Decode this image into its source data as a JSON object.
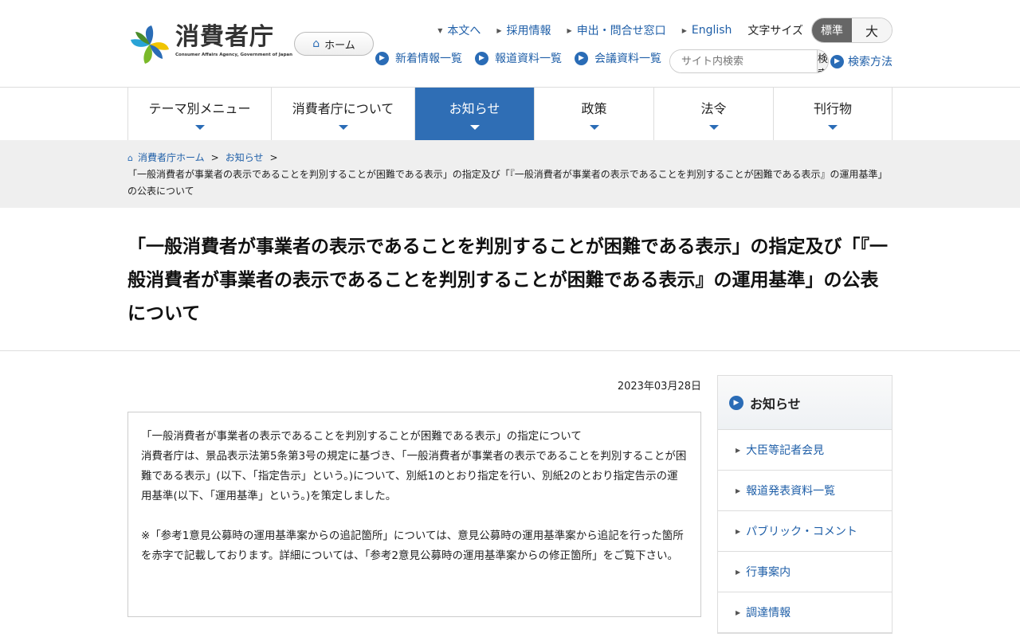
{
  "header": {
    "logo_text": "消費者庁",
    "logo_subtext": "Consumer Affairs Agency, Government of Japan",
    "home_label": "ホーム",
    "top_links": [
      "本文へ",
      "採用情報",
      "申出・問合せ窓口",
      "English"
    ],
    "font_size_label": "文字サイズ",
    "font_size_options": [
      "標準",
      "大"
    ],
    "sub_links": [
      "新着情報一覧",
      "報道資料一覧",
      "会議資料一覧"
    ],
    "search_placeholder": "サイト内検索",
    "search_button": "検索",
    "search_help": "検索方法"
  },
  "global_nav": [
    {
      "label": "テーマ別メニュー",
      "active": false
    },
    {
      "label": "消費者庁について",
      "active": false
    },
    {
      "label": "お知らせ",
      "active": true
    },
    {
      "label": "政策",
      "active": false
    },
    {
      "label": "法令",
      "active": false
    },
    {
      "label": "刊行物",
      "active": false
    }
  ],
  "breadcrumb": {
    "home": "消費者庁ホーム",
    "section": "お知らせ",
    "separator": ">",
    "current": "「一般消費者が事業者の表示であることを判別することが困難である表示」の指定及び「『一般消費者が事業者の表示であることを判別することが困難である表示』の運用基準」の公表について"
  },
  "page_title": "「一般消費者が事業者の表示であることを判別することが困難である表示」の指定及び「『一般消費者が事業者の表示であることを判別することが困難である表示』の運用基準」の公表について",
  "date": "2023年03月28日",
  "content": {
    "heading": "「一般消費者が事業者の表示であることを判別することが困難である表示」の指定について",
    "para1": "消費者庁は、景品表示法第5条第3号の規定に基づき、「一般消費者が事業者の表示であることを判別することが困難である表示」(以下、「指定告示」という。)について、別紙1のとおり指定を行い、別紙2のとおり指定告示の運用基準(以下、「運用基準」という。)を策定しました。",
    "para2": "※「参考1意見公募時の運用基準案からの追記箇所」については、意見公募時の運用基準案から追記を行った箇所を赤字で記載しております。詳細については、「参考2意見公募時の運用基準案からの修正箇所」をご覧下さい。"
  },
  "sidebar": {
    "title": "お知らせ",
    "items": [
      "大臣等記者会見",
      "報道発表資料一覧",
      "パブリック・コメント",
      "行事案内",
      "調達情報"
    ]
  },
  "colors": {
    "accent": "#2f6eb5",
    "link": "#1f5fa8",
    "breadcrumb_bg": "#efefef"
  }
}
